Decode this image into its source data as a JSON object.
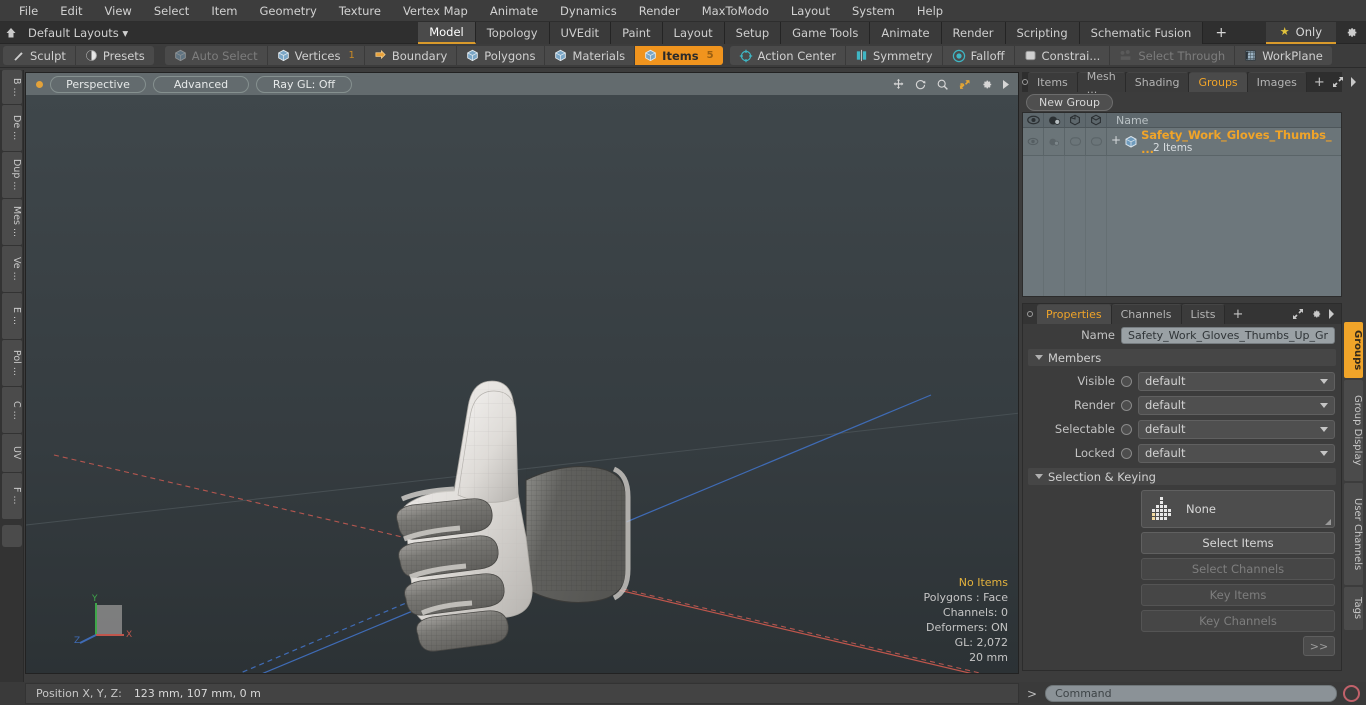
{
  "app": {
    "title": "Modo 3D Modeling Application",
    "accent": "#f0a429",
    "viewport_bg": "#343b3e"
  },
  "menubar": {
    "items": [
      "File",
      "Edit",
      "View",
      "Select",
      "Item",
      "Geometry",
      "Texture",
      "Vertex Map",
      "Animate",
      "Dynamics",
      "Render",
      "MaxToModo",
      "Layout",
      "System",
      "Help"
    ]
  },
  "layoutbar": {
    "home_icon": "home-icon",
    "layouts_label": "Default Layouts",
    "layouts_caret": "▾",
    "tabs": [
      {
        "label": "Model",
        "active": true
      },
      {
        "label": "Topology",
        "active": false
      },
      {
        "label": "UVEdit",
        "active": false
      },
      {
        "label": "Paint",
        "active": false
      },
      {
        "label": "Layout",
        "active": false
      },
      {
        "label": "Setup",
        "active": false
      },
      {
        "label": "Game Tools",
        "active": false
      },
      {
        "label": "Animate",
        "active": false
      },
      {
        "label": "Render",
        "active": false
      },
      {
        "label": "Scripting",
        "active": false
      },
      {
        "label": "Schematic Fusion",
        "active": false
      }
    ],
    "add_tab": "+",
    "only_label": "Only",
    "only_star": "★",
    "gear_icon": "gear-icon"
  },
  "modebar": {
    "left_group": [
      {
        "label": "Sculpt",
        "icon": "sculpt-icon",
        "state": "normal"
      },
      {
        "label": "Presets",
        "icon": "presets-icon",
        "state": "normal"
      }
    ],
    "select_group": [
      {
        "label": "Auto Select",
        "icon": "cube-icon",
        "state": "dim",
        "count": ""
      },
      {
        "label": "Vertices",
        "icon": "cube-icon",
        "state": "normal",
        "count": "1"
      },
      {
        "label": "Boundary",
        "icon": "boundary-icon",
        "state": "normal",
        "count": ""
      },
      {
        "label": "Polygons",
        "icon": "cube-icon",
        "state": "normal",
        "count": ""
      },
      {
        "label": "Materials",
        "icon": "cube-icon",
        "state": "normal",
        "count": ""
      },
      {
        "label": "Items",
        "icon": "cube-icon",
        "state": "selected",
        "count": "5"
      }
    ],
    "right_group": [
      {
        "label": "Action Center",
        "icon": "action-center-icon",
        "state": "normal"
      },
      {
        "label": "Symmetry",
        "icon": "symmetry-icon",
        "state": "normal"
      },
      {
        "label": "Falloff",
        "icon": "falloff-icon",
        "state": "normal"
      },
      {
        "label": "Constrai...",
        "icon": "constraint-icon",
        "state": "normal"
      },
      {
        "label": "Select Through",
        "icon": "select-through-icon",
        "state": "dim"
      },
      {
        "label": "WorkPlane",
        "icon": "workplane-icon",
        "state": "normal"
      }
    ]
  },
  "left_tabs": [
    "B ...",
    "De ...",
    "Dup ...",
    "Mes ...",
    "Ve ...",
    "E ...",
    "Pol ...",
    "C ...",
    "UV",
    "F ..."
  ],
  "viewport": {
    "pills": [
      "Perspective",
      "Advanced",
      "Ray GL: Off"
    ],
    "icons": [
      "move-icon",
      "rotate-icon",
      "magnify-icon",
      "fit-icon",
      "gear-icon",
      "play-arrow-icon"
    ],
    "overlay": {
      "items_status": "No Items",
      "polygons": "Polygons : Face",
      "channels": "Channels: 0",
      "deformers": "Deformers: ON",
      "gl": "GL: 2,072",
      "scale": "20 mm"
    },
    "gizmo": {
      "x": "X",
      "y": "Y",
      "z": "Z"
    }
  },
  "right_panel": {
    "top_tabs": [
      {
        "label": "Items",
        "active": false
      },
      {
        "label": "Mesh ...",
        "active": false
      },
      {
        "label": "Shading",
        "active": false
      },
      {
        "label": "Groups",
        "active": true
      },
      {
        "label": "Images",
        "active": false
      }
    ],
    "add_tab": "+",
    "new_group_button": "New Group",
    "list_header": {
      "col_visible": "eye-icon",
      "col_render": "render-icon",
      "col_shade1": "shade-icon-1",
      "col_shade2": "shade-icon-2",
      "name": "Name"
    },
    "rows": [
      {
        "name": "Safety_Work_Gloves_Thumbs_ ...",
        "sub": "2 Items",
        "expander": "+",
        "icon": "group-cube-icon"
      }
    ]
  },
  "properties": {
    "tabs": [
      {
        "label": "Properties",
        "active": true
      },
      {
        "label": "Channels",
        "active": false
      },
      {
        "label": "Lists",
        "active": false
      }
    ],
    "add_tab": "+",
    "name_label": "Name",
    "name_value": "Safety_Work_Gloves_Thumbs_Up_Gr",
    "members_section": "Members",
    "members": [
      {
        "label": "Visible",
        "value": "default"
      },
      {
        "label": "Render",
        "value": "default"
      },
      {
        "label": "Selectable",
        "value": "default"
      },
      {
        "label": "Locked",
        "value": "default"
      }
    ],
    "selection_section": "Selection & Keying",
    "none_button": "None",
    "buttons": [
      {
        "label": "Select Items",
        "enabled": true
      },
      {
        "label": "Select Channels",
        "enabled": false
      },
      {
        "label": "Key Items",
        "enabled": false
      },
      {
        "label": "Key Channels",
        "enabled": false
      }
    ],
    "more_button": ">>"
  },
  "right_tabs": [
    {
      "label": "Groups",
      "active": true
    },
    {
      "label": "Group Display",
      "active": false
    },
    {
      "label": "User Channels",
      "active": false
    },
    {
      "label": "Tags",
      "active": false
    }
  ],
  "statusbar": {
    "position_label": "Position X, Y, Z:",
    "position_value": "123 mm, 107 mm, 0 m",
    "command_prompt": ">",
    "command_placeholder": "Command",
    "record_icon": "record-icon"
  }
}
